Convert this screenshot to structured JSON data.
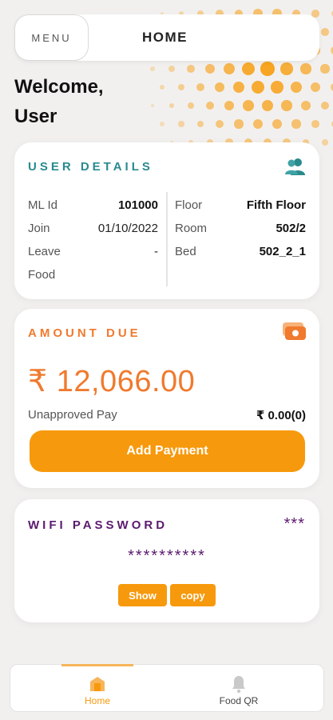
{
  "header": {
    "menu_label": "MENU",
    "title": "HOME"
  },
  "welcome": {
    "line1": "Welcome,",
    "line2": "User"
  },
  "user_details": {
    "title": "USER DETAILS",
    "left": [
      {
        "label": "ML Id",
        "value": "101000"
      },
      {
        "label": "Join",
        "value": "01/10/2022"
      },
      {
        "label": "Leave",
        "value": "-"
      },
      {
        "label": "Food",
        "value": ""
      }
    ],
    "right": [
      {
        "label": "Floor",
        "value": "Fifth Floor"
      },
      {
        "label": "Room",
        "value": "502/2"
      },
      {
        "label": "Bed",
        "value": "502_2_1"
      }
    ]
  },
  "amount_due": {
    "title": "AMOUNT DUE",
    "amount": "₹ 12,066.00",
    "unapproved_label": "Unapproved Pay",
    "unapproved_value": "₹ 0.00(0)",
    "button_label": "Add Payment"
  },
  "wifi": {
    "title": "WIFI PASSWORD",
    "indicator": "***",
    "password_masked": "**********",
    "show_label": "Show",
    "copy_label": "copy"
  },
  "bottom_nav": {
    "items": [
      {
        "label": "Home",
        "icon": "home-icon",
        "active": true
      },
      {
        "label": "Food QR",
        "icon": "bell-icon",
        "active": false
      }
    ]
  },
  "colors": {
    "accent_orange": "#f7990c",
    "amount_orange": "#f07a2e",
    "teal": "#2a8a8e",
    "purple": "#5b1a6e"
  }
}
